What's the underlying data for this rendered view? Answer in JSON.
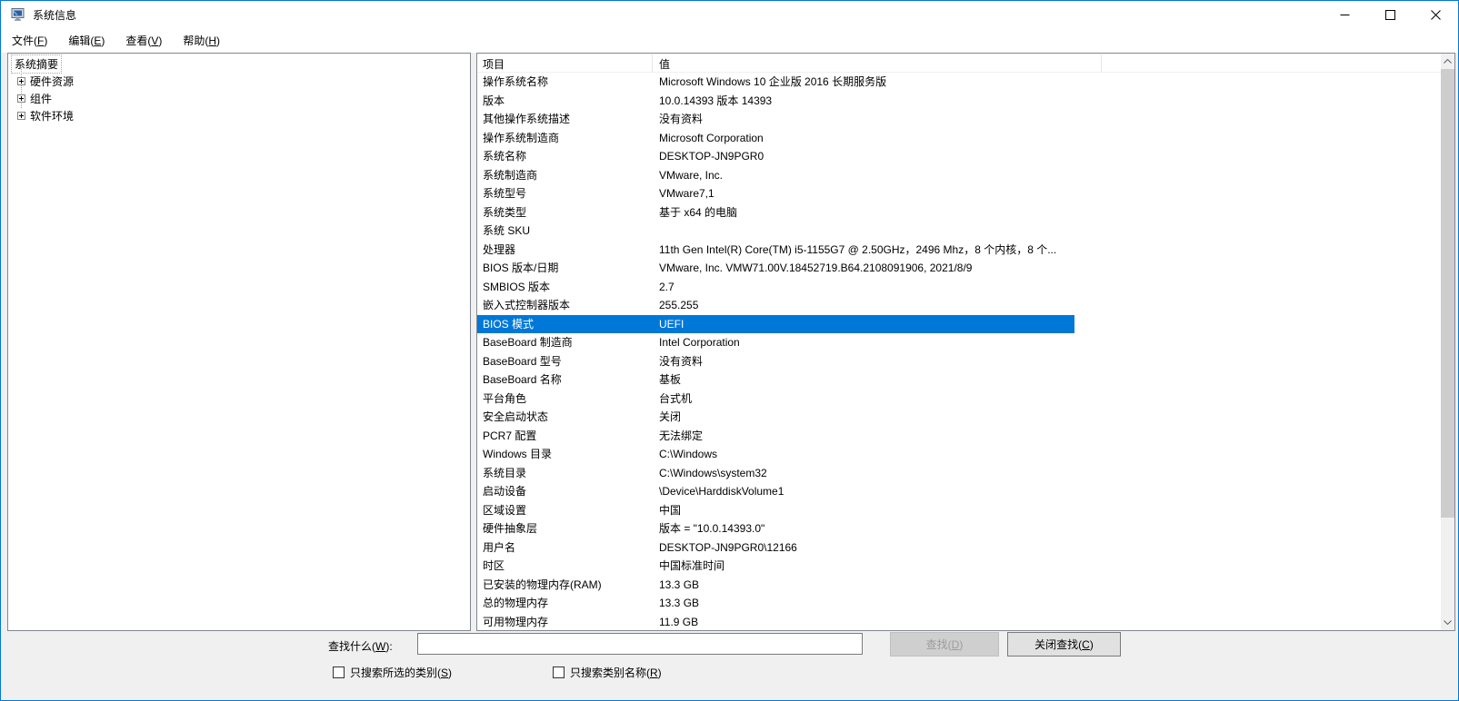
{
  "window": {
    "title": "系统信息"
  },
  "icons": {
    "app": "system-info-monitor-icon",
    "minimize": "minimize-icon",
    "maximize": "maximize-icon",
    "close": "close-icon",
    "scroll_up": "chevron-up-icon",
    "scroll_down": "chevron-down-icon",
    "tree_expand": "plus-expand-icon"
  },
  "menu": {
    "items": [
      {
        "name": "file",
        "pre": "文件(",
        "key": "F",
        "post": ")"
      },
      {
        "name": "edit",
        "pre": "编辑(",
        "key": "E",
        "post": ")"
      },
      {
        "name": "view",
        "pre": "查看(",
        "key": "V",
        "post": ")"
      },
      {
        "name": "help",
        "pre": "帮助(",
        "key": "H",
        "post": ")"
      }
    ]
  },
  "tree": {
    "root": "系统摘要",
    "items": [
      "硬件资源",
      "组件",
      "软件环境"
    ]
  },
  "list": {
    "columns": [
      "项目",
      "值"
    ],
    "selected_index": 13,
    "rows": [
      {
        "item": "操作系统名称",
        "value": "Microsoft Windows 10 企业版 2016 长期服务版"
      },
      {
        "item": "版本",
        "value": "10.0.14393 版本 14393"
      },
      {
        "item": "其他操作系统描述",
        "value": "没有资料"
      },
      {
        "item": "操作系统制造商",
        "value": "Microsoft Corporation"
      },
      {
        "item": "系统名称",
        "value": "DESKTOP-JN9PGR0"
      },
      {
        "item": "系统制造商",
        "value": "VMware, Inc."
      },
      {
        "item": "系统型号",
        "value": "VMware7,1"
      },
      {
        "item": "系统类型",
        "value": "基于 x64 的电脑"
      },
      {
        "item": "系统 SKU",
        "value": ""
      },
      {
        "item": "处理器",
        "value": "11th Gen Intel(R) Core(TM) i5-1155G7 @ 2.50GHz，2496 Mhz，8 个内核，8 个..."
      },
      {
        "item": "BIOS 版本/日期",
        "value": "VMware, Inc. VMW71.00V.18452719.B64.2108091906, 2021/8/9"
      },
      {
        "item": "SMBIOS 版本",
        "value": "2.7"
      },
      {
        "item": "嵌入式控制器版本",
        "value": "255.255"
      },
      {
        "item": "BIOS 模式",
        "value": "UEFI"
      },
      {
        "item": "BaseBoard 制造商",
        "value": "Intel Corporation"
      },
      {
        "item": "BaseBoard 型号",
        "value": "没有资料"
      },
      {
        "item": "BaseBoard 名称",
        "value": "基板"
      },
      {
        "item": "平台角色",
        "value": "台式机"
      },
      {
        "item": "安全启动状态",
        "value": "关闭"
      },
      {
        "item": "PCR7 配置",
        "value": "无法绑定"
      },
      {
        "item": "Windows 目录",
        "value": "C:\\Windows"
      },
      {
        "item": "系统目录",
        "value": "C:\\Windows\\system32"
      },
      {
        "item": "启动设备",
        "value": "\\Device\\HarddiskVolume1"
      },
      {
        "item": "区域设置",
        "value": "中国"
      },
      {
        "item": "硬件抽象层",
        "value": "版本 = \"10.0.14393.0\""
      },
      {
        "item": "用户名",
        "value": "DESKTOP-JN9PGR0\\12166"
      },
      {
        "item": "时区",
        "value": "中国标准时间"
      },
      {
        "item": "已安装的物理内存(RAM)",
        "value": "13.3 GB"
      },
      {
        "item": "总的物理内存",
        "value": "13.3 GB"
      },
      {
        "item": "可用物理内存",
        "value": "11.9 GB"
      }
    ]
  },
  "find": {
    "label": {
      "pre": "查找什么(",
      "key": "W",
      "post": "):"
    },
    "input_value": "",
    "buttons": [
      {
        "name": "find",
        "pre": "查找(",
        "key": "D",
        "post": ")",
        "enabled": false
      },
      {
        "name": "close-find",
        "pre": "关闭查找(",
        "key": "C",
        "post": ")",
        "enabled": true
      }
    ],
    "checkboxes": [
      {
        "name": "search-selected-category",
        "pre": "只搜索所选的类别(",
        "key": "S",
        "post": ")",
        "checked": false
      },
      {
        "name": "search-category-names",
        "pre": "只搜索类别名称(",
        "key": "R",
        "post": ")",
        "checked": false
      }
    ]
  },
  "colors": {
    "selection": "#0078d7",
    "window_border": "#0078d7",
    "panel_border": "#828790",
    "scroll_thumb": "#cdcdcd"
  }
}
